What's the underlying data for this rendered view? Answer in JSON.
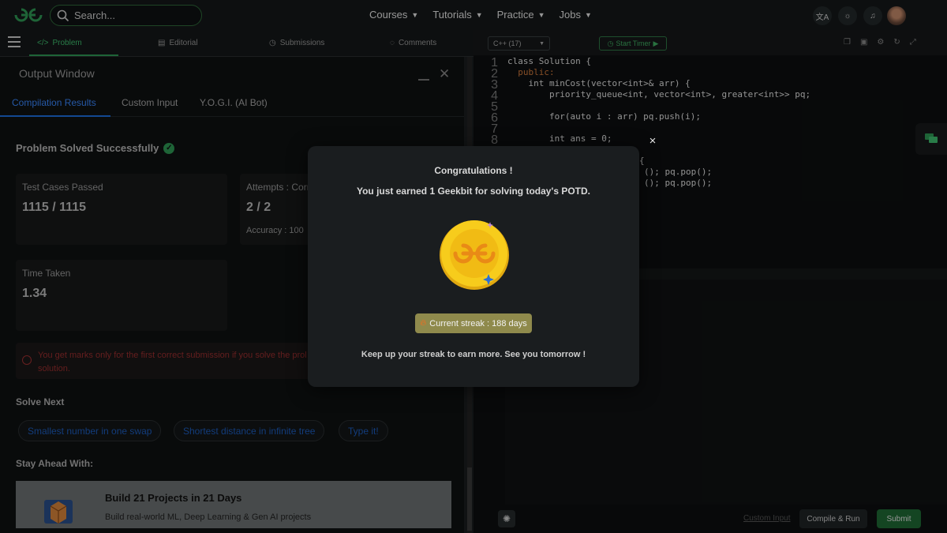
{
  "topbar": {
    "search_placeholder": "Search...",
    "nav": [
      "Courses",
      "Tutorials",
      "Practice",
      "Jobs"
    ],
    "icons": [
      "translate-icon",
      "theme-icon",
      "bell-icon"
    ]
  },
  "problem_tabs": {
    "problem": "Problem",
    "editorial": "Editorial",
    "submissions": "Submissions",
    "comments": "Comments"
  },
  "output": {
    "title": "Output Window",
    "tabs": [
      "Compilation Results",
      "Custom Input",
      "Y.O.G.I. (AI Bot)"
    ],
    "solved_text": "Problem Solved Successfully",
    "cards": {
      "test_label": "Test Cases Passed",
      "test_value": "1115 / 1115",
      "attempts_label": "Attempts : Corr",
      "attempts_value": "2 / 2",
      "accuracy_label": "Accuracy : 100",
      "time_label": "Time Taken",
      "time_value": "1.34"
    },
    "warning_line1": "You get marks only for the first correct submission if you solve the prol",
    "warning_line2": "solution.",
    "solve_next_title": "Solve Next",
    "solve_next_chips": [
      "Smallest number in one swap",
      "Shortest distance in infinite tree",
      "Type it!"
    ],
    "stay_ahead": "Stay Ahead With:",
    "promo_title": "Build 21 Projects in 21 Days",
    "promo_sub": "Build real-world ML, Deep Learning & Gen AI projects"
  },
  "editor": {
    "language": "C++ (17)",
    "timer_label": "Start Timer",
    "line_numbers": [
      "1",
      "2",
      "3",
      "4",
      "5",
      "6",
      "7",
      "8"
    ],
    "code_lines": [
      "class Solution {",
      "  public:",
      "    int minCost(vector<int>& arr) {",
      "        priority_queue<int, vector<int>, greater<int>> pq;",
      "",
      "        for(auto i : arr) pq.push(i);",
      "",
      "        int ans = 0;"
    ],
    "partial_lines": [
      "{",
      "(); pq.pop();",
      "(); pq.pop();"
    ],
    "custom_input_link": "Custom Input",
    "compile_run": "Compile & Run",
    "submit": "Submit"
  },
  "modal": {
    "title": "Congratulations !",
    "subtitle": "You just earned 1 Geekbit for solving today's POTD.",
    "streak": "Current streak : 188 days",
    "footer": "Keep up your streak to earn more. See you tomorrow !",
    "close": "×"
  },
  "colors": {
    "accent_green": "#2f9a55",
    "accent_blue": "#1e6fe0",
    "coin_gold": "#f2c21a",
    "streak_bg": "#8f8a4c"
  }
}
